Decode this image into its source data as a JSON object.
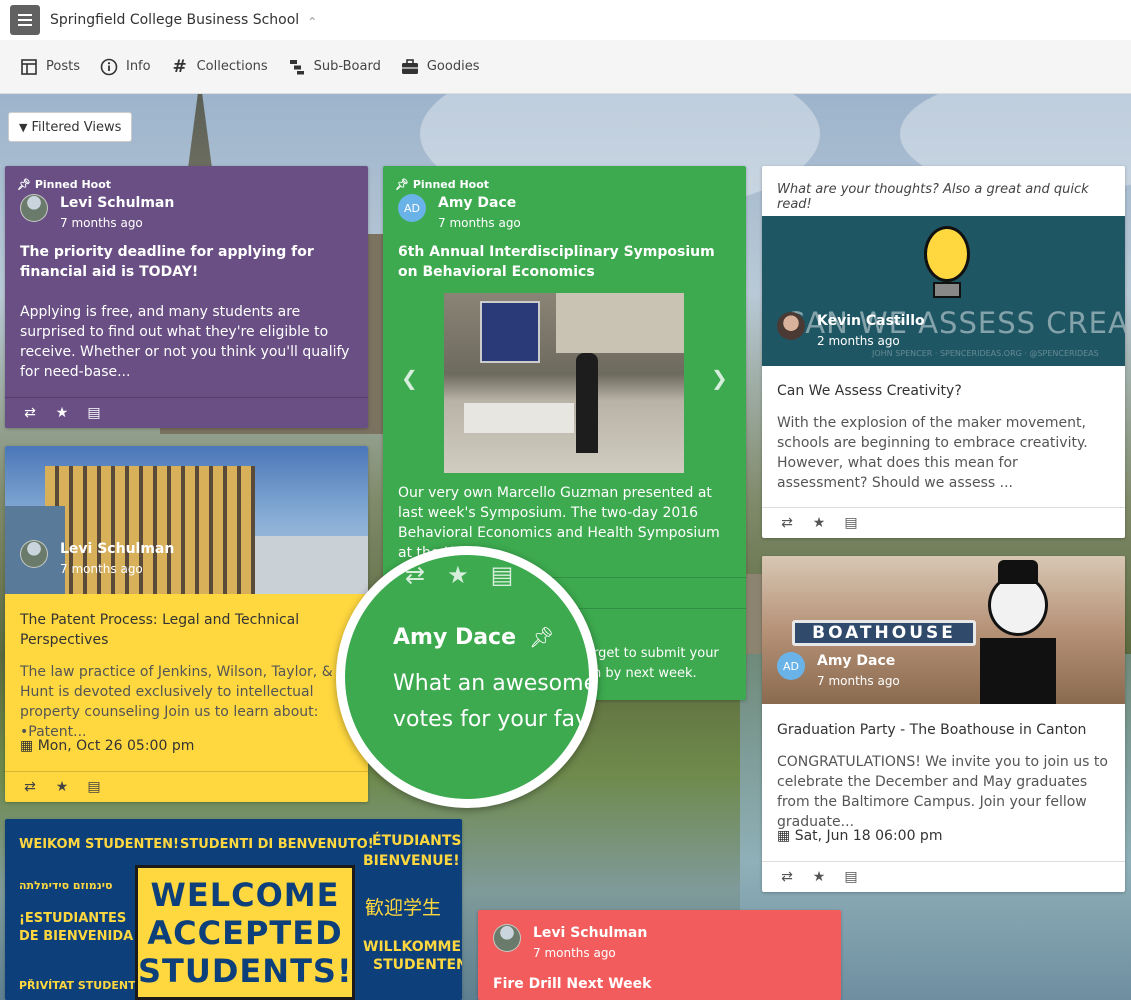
{
  "topbar": {
    "title": "Springfield College Business School"
  },
  "nav": [
    {
      "label": "Posts"
    },
    {
      "label": "Info"
    },
    {
      "label": "Collections"
    },
    {
      "label": "Sub-Board"
    },
    {
      "label": "Goodies"
    }
  ],
  "filter": {
    "label": "Filtered Views"
  },
  "pinned_label": "Pinned Hoot",
  "cards": {
    "c1": {
      "author": "Levi Schulman",
      "time": "7 months ago",
      "title": "The priority deadline for applying for financial aid is TODAY!",
      "body": "Applying is free, and many students are surprised to find out what they're eligible to receive. Whether or not you think you'll qualify for need-base..."
    },
    "c2": {
      "author": "Levi Schulman",
      "time": "7 months ago",
      "title": "The Patent Process: Legal and Technical Perspectives",
      "body": "The law practice of Jenkins, Wilson, Taylor, & Hunt is devoted exclusively to intellectual property counseling Join us to learn about: •Patent...",
      "date": "Mon, Oct 26 05:00 pm"
    },
    "c3": {
      "lines": [
        "WEIKOM STUDENTEN!",
        "STUDENTI DI BENVENUTO!",
        "ÉTUDIANTS",
        "BIENVENUE!",
        "סינמוזם סידימלתה",
        "¡ESTUDIANTES",
        "DE BIENVENIDA!",
        "歓迎学生",
        "WILLKOMMEN",
        "STUDENTEN!",
        "PŘIVÍTAT STUDENTY!"
      ],
      "sign": [
        "WELCOME",
        "ACCEPTED",
        "STUDENTS!"
      ]
    },
    "c4": {
      "avatar": "AD",
      "author": "Amy Dace",
      "time": "7 months ago",
      "title": "6th Annual Interdisciplinary Symposium on Behavioral Economics",
      "body": "Our very own Marcello Guzman presented at last week's Symposium. The two-day 2016 Behavioral Economics and Health Symposium at the Univ...",
      "tail": "rget to submit your\nn by next week."
    },
    "c5": {
      "author": "Levi Schulman",
      "time": "7 months ago",
      "title": "Fire Drill Next Week"
    },
    "c6": {
      "header": "What are your thoughts? Also a great and quick read!",
      "author": "Kevin Castillo",
      "time": "2 months ago",
      "image_text": "CAN WE ASSESS CREATIVITY?",
      "image_credit": "JOHN SPENCER · SPENCERIDEAS.ORG · @SPENCERIDEAS",
      "title": "Can We Assess Creativity?",
      "body": "With the explosion of the maker movement, schools are beginning to embrace creativity. However, what does this mean for assessment? Should we assess ..."
    },
    "c7": {
      "avatar": "AD",
      "author": "Amy Dace",
      "time": "7 months ago",
      "image_text": "BOATHOUSE",
      "title": "Graduation Party - The Boathouse in Canton",
      "body": "CONGRATULATIONS! We invite you to join us to celebrate the December and May graduates from the Baltimore Campus. Join your fellow graduate...",
      "date": "Sat, Jun 18 06:00 pm"
    }
  },
  "magnifier": {
    "name": "Amy Dace",
    "line1": "What an awesome",
    "line2": "votes for your fav"
  },
  "colors": {
    "purple": "#6a4f84",
    "green": "#3daa4f",
    "yellow": "#ffd83f",
    "red": "#f25c5c"
  }
}
